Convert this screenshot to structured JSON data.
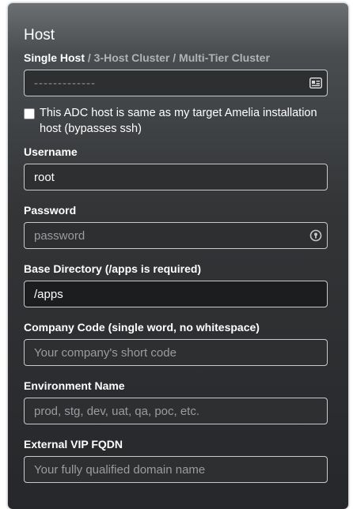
{
  "host_section": {
    "title": "Host",
    "mode_selected": "Single Host",
    "mode_other": " / 3-Host Cluster / Multi-Tier Cluster",
    "host_input": {
      "value": "",
      "placeholder": "-------------",
      "icon": "id-card-icon"
    },
    "same_host_checkbox": {
      "checked": false,
      "label": "This ADC host is same as my target Amelia installation host (bypasses ssh)"
    }
  },
  "fields": {
    "username": {
      "label": "Username",
      "value": "root",
      "placeholder": ""
    },
    "password": {
      "label": "Password",
      "value": "",
      "placeholder": "password",
      "icon": "password-manager-icon"
    },
    "base_directory": {
      "label": "Base Directory (/apps is required)",
      "value": "/apps",
      "placeholder": ""
    },
    "company_code": {
      "label": "Company Code (single word, no whitespace)",
      "value": "",
      "placeholder": "Your company's short code"
    },
    "environment_name": {
      "label": "Environment Name",
      "value": "",
      "placeholder": "prod, stg, dev, uat, qa, poc, etc."
    },
    "external_vip_fqdn": {
      "label": "External VIP FQDN",
      "value": "",
      "placeholder": "Your fully qualified domain name"
    }
  },
  "colors": {
    "panel_top": "#6c6f72",
    "panel_bottom": "#25272a",
    "text": "#ffffff",
    "muted_text": "#b0b3b6",
    "field_border": "#c8cacc"
  }
}
